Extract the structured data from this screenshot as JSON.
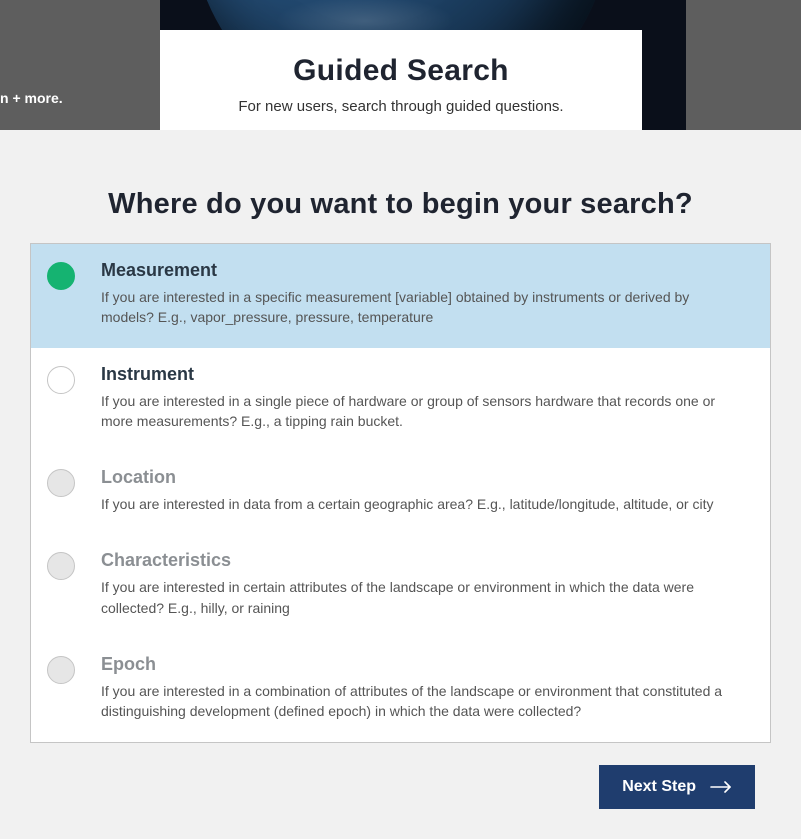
{
  "hero": {
    "left_fragment": "n + more."
  },
  "card": {
    "title": "Guided Search",
    "subtitle": "For new users, search through guided questions."
  },
  "question": "Where do you want to begin your search?",
  "options": [
    {
      "key": "measurement",
      "title": "Measurement",
      "desc": "If you are interested in a specific measurement [variable] obtained by instruments or derived by models? E.g., vapor_pressure, pressure, temperature",
      "selected": true,
      "enabled": true
    },
    {
      "key": "instrument",
      "title": "Instrument",
      "desc": "If you are interested in a single piece of hardware or group of sensors hardware that records one or more measurements? E.g., a tipping rain bucket.",
      "selected": false,
      "enabled": true
    },
    {
      "key": "location",
      "title": "Location",
      "desc": "If you are interested in data from a certain geographic area? E.g., latitude/longitude, altitude, or city",
      "selected": false,
      "enabled": false
    },
    {
      "key": "characteristics",
      "title": "Characteristics",
      "desc": "If you are interested in certain attributes of the landscape or environment in which the data were collected? E.g., hilly, or raining",
      "selected": false,
      "enabled": false
    },
    {
      "key": "epoch",
      "title": "Epoch",
      "desc": "If you are interested in a combination of attributes of the landscape or environment that constituted a distinguishing development (defined epoch) in which the data were collected?",
      "selected": false,
      "enabled": false
    }
  ],
  "footer": {
    "next_label": "Next Step"
  }
}
